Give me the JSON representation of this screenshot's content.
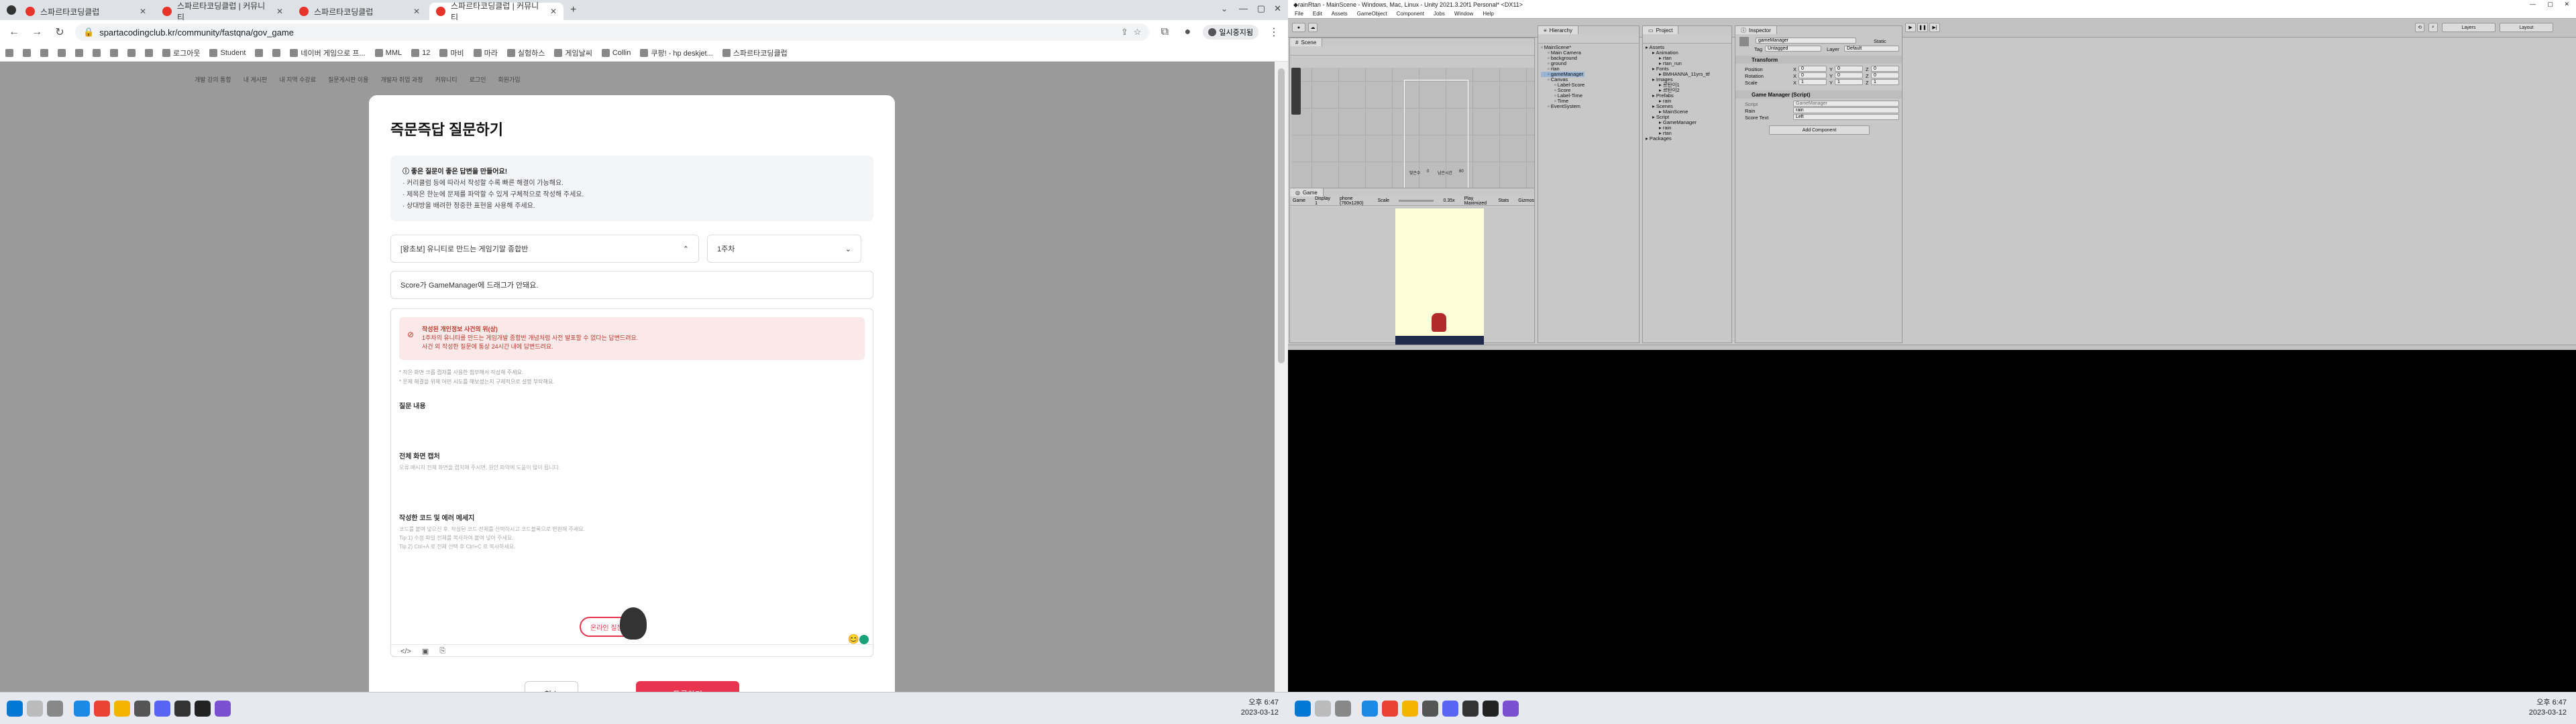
{
  "chrome": {
    "tabs": [
      {
        "label": "스파르타코딩클럽"
      },
      {
        "label": "스파르타코딩클럽 | 커뮤니티"
      },
      {
        "label": "스파르타코딩클럽"
      },
      {
        "label": "스파르타코딩클럽 | 커뮤니티"
      }
    ],
    "new_tab": "+",
    "url": "spartacodingclub.kr/community/fastqna/gov_game",
    "pause_label": "일시중지됨",
    "bookmarks": [
      "",
      "",
      "",
      "",
      "",
      "",
      "",
      "",
      "",
      "로그아웃",
      "Student",
      "",
      "",
      "네이버 게임으로 프...",
      "MML",
      "12",
      "마비",
      "마라",
      "실험하스",
      "게임날씨",
      "Collin",
      "쿠팡! - hp deskjet...",
      "스파르타코딩클럽"
    ]
  },
  "site": {
    "nav": [
      "개발 강의 통합",
      "내 게시판",
      "내 지역 수강료",
      "질문게시판 이용",
      "개발자 취업 과정",
      "커뮤니티",
      "로그인",
      "회원가입"
    ],
    "modal_title": "즉문즉답 질문하기",
    "tips_title": "좋은 질문이 좋은 답변을 만들어요!",
    "tips": [
      "· 커리큘럼 등에 따라서 작성할 수록 빠른 해결이 가능해요.",
      "· 제목은 한눈에 문제를 파악할 수 있게 구체적으로 작성해 주세요.",
      "· 상대방을 배려한 정중한 표현을 사용해 주세요."
    ],
    "course_select": "[왕초보] 유니티로 만드는 게임기말 종합반",
    "week_select": "1주차",
    "question_title": "Score가 GameManager에 드래그가 안돼요.",
    "warning_title": "작성된 개인정보 사건의 위(상)",
    "warning_lines": [
      "1주차의 유니티를 만드는 게임개발 종합반 개념처럼 사전 발표할 수 없다는 답변드려요.",
      "사건 외 작성한 질문에 통상 24시간 내에 답변드려요."
    ],
    "hint_lines": [
      "* 작은 화면 크롭 캡처를 사용한 첨부해서 작성해 주세요.",
      "* 문제 해결을 위해 어떤 시도를 해보셨는지 구체적으로 설명 부탁해요."
    ],
    "section_question": "질문 내용",
    "section_tried": "전체 화면 캡처",
    "section_tried_hint": "오류 메시지 전체 화면을 캡처해 주시면, 원인 파악에 도움이 많이 됩니다.",
    "section_code": "작성한 코드 및 에러 메세지",
    "section_code_hint": [
      "코드를 붙여 넣으신 후, 작성된 코드 전체를 선택하시고 코드블록으로 변환해 주세요.",
      "Tip 1) 수정 파일 전체를 복사하여 붙여 넣어 주세요.",
      "Tip 2) Ctrl+A 로 전체 선택 후 Ctrl+C 로 복사하세요."
    ],
    "cancel": "취소",
    "submit": "등록하기",
    "floating_q": "온라인 질문하기"
  },
  "taskbar1": {
    "time": "오후 6:47",
    "date": "2023-03-12"
  },
  "unity": {
    "title": "rainRtan - MainScene - Windows, Mac, Linux - Unity 2021.3.20f1 Personal* <DX11>",
    "menu": [
      "File",
      "Edit",
      "Assets",
      "GameObject",
      "Component",
      "Jobs",
      "Window",
      "Help"
    ],
    "layers": "Layers",
    "layout": "Layout",
    "scene_tab": "Scene",
    "game_tab": "Game",
    "hierarchy_tab": "Hierarchy",
    "project_tab": "Project",
    "inspector_tab": "Inspector",
    "hierarchy": [
      {
        "name": "MainScene*",
        "indent": 0
      },
      {
        "name": "Main Camera",
        "indent": 1
      },
      {
        "name": "background",
        "indent": 1
      },
      {
        "name": "ground",
        "indent": 1
      },
      {
        "name": "rtan",
        "indent": 1
      },
      {
        "name": "gameManager",
        "indent": 1,
        "selected": true
      },
      {
        "name": "Canvas",
        "indent": 1
      },
      {
        "name": "Label-Score",
        "indent": 2
      },
      {
        "name": "Score",
        "indent": 2
      },
      {
        "name": "Label-Time",
        "indent": 2
      },
      {
        "name": "Time",
        "indent": 2
      },
      {
        "name": "EventSystem",
        "indent": 1
      }
    ],
    "project": [
      {
        "name": "Assets",
        "indent": 0
      },
      {
        "name": "Animation",
        "indent": 1
      },
      {
        "name": "rtan",
        "indent": 2
      },
      {
        "name": "rtan_run",
        "indent": 2
      },
      {
        "name": "Fonts",
        "indent": 1
      },
      {
        "name": "BMHANNA_11yrs_ttf",
        "indent": 2
      },
      {
        "name": "Images",
        "indent": 1
      },
      {
        "name": "르탄이1",
        "indent": 2
      },
      {
        "name": "르탄이2",
        "indent": 2
      },
      {
        "name": "Prefabs",
        "indent": 1
      },
      {
        "name": "rain",
        "indent": 2
      },
      {
        "name": "Scenes",
        "indent": 1
      },
      {
        "name": "MainScene",
        "indent": 2
      },
      {
        "name": "Script",
        "indent": 1
      },
      {
        "name": "GameManager",
        "indent": 2
      },
      {
        "name": "rain",
        "indent": 2
      },
      {
        "name": "rtan",
        "indent": 2
      },
      {
        "name": "Packages",
        "indent": 0
      }
    ],
    "inspector": {
      "object_name": "gameManager",
      "static": "Static",
      "tag_label": "Tag",
      "tag": "Untagged",
      "layer_label": "Layer",
      "layer": "Default",
      "transform": "Transform",
      "position": "Position",
      "rotation": "Rotation",
      "scale": "Scale",
      "vals": [
        "0",
        "0",
        "0",
        "0",
        "0",
        "0",
        "1",
        "1",
        "1"
      ],
      "script_comp": "Game Manager (Script)",
      "script_label": "Script",
      "script_val": "GameManager",
      "rain_label": "Rain",
      "rain_val": "rain",
      "scoretext_label": "Score Text",
      "scoretext_val": "Left",
      "add_component": "Add Component"
    },
    "game_bar": {
      "display_mode": "Game",
      "display": "Display 1",
      "resolution": "phone (760x1280)",
      "scale_label": "Scale",
      "scale_val": "0.35x",
      "play_mode": "Play Maximized",
      "stats": "Stats",
      "gizmos": "Gizmos"
    },
    "hud": {
      "score_label": "맞은수",
      "score": "0",
      "time_label": "남은시간",
      "time": "60"
    }
  },
  "taskbar2": {
    "time": "오후 6:47",
    "date": "2023-03-12"
  },
  "colors": {
    "brand": "#e8344e",
    "selection": "#9ab4d6"
  }
}
